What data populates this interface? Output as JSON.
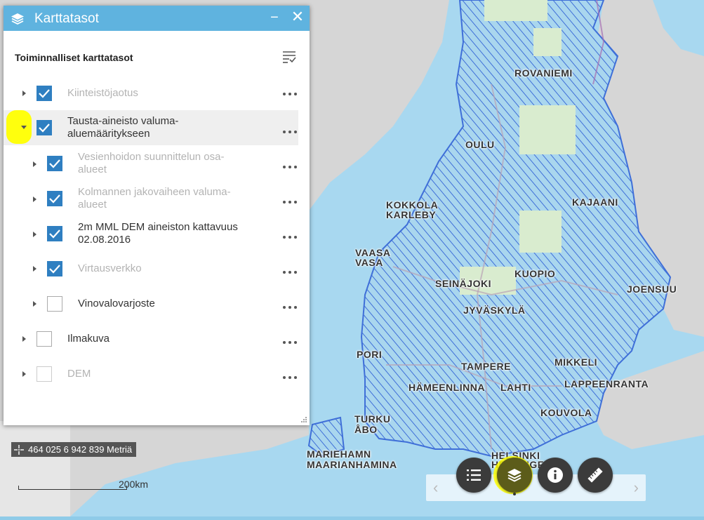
{
  "panel": {
    "title": "Karttatasot",
    "minimize_label": "−",
    "close_label": "✕",
    "section_title": "Toiminnalliset karttatasot",
    "layers": [
      {
        "label": "Kiinteistöjaotus",
        "checked": true,
        "expanded": false,
        "dim": true
      },
      {
        "label": "Tausta-aineisto valuma-aluemääritykseen",
        "checked": true,
        "expanded": true,
        "dim": false,
        "selected": true
      },
      {
        "label": "Vesienhoidon suunnittelun osa-alueet",
        "checked": true,
        "expanded": false,
        "dim": true,
        "child": true
      },
      {
        "label": "Kolmannen jakovaiheen valuma-alueet",
        "checked": true,
        "expanded": false,
        "dim": true,
        "child": true
      },
      {
        "label": "2m MML DEM aineiston kattavuus 02.08.2016",
        "checked": true,
        "expanded": false,
        "dim": false,
        "child": true
      },
      {
        "label": "Virtausverkko",
        "checked": true,
        "expanded": false,
        "dim": true,
        "child": true
      },
      {
        "label": "Vinovalovarjoste",
        "checked": false,
        "expanded": false,
        "dim": false,
        "child": true
      },
      {
        "label": "Ilmakuva",
        "checked": false,
        "expanded": false,
        "dim": false
      },
      {
        "label": "DEM",
        "checked": false,
        "expanded": false,
        "dim": true
      }
    ],
    "layer_lines": [
      [
        "Kiinteistöjaotus"
      ],
      [
        "Tausta-aineisto valuma-",
        "aluemääritykseen"
      ],
      [
        "Vesienhoidon suunnittelun osa-",
        "alueet"
      ],
      [
        "Kolmannen jakovaiheen valuma-",
        "alueet"
      ],
      [
        "2m MML DEM aineiston kattavuus",
        "02.08.2016"
      ],
      [
        "Virtausverkko"
      ],
      [
        "Vinovalovarjoste"
      ],
      [
        "Ilmakuva"
      ],
      [
        "DEM"
      ]
    ]
  },
  "coordinates": {
    "text": "464 025 6 942 839 Metriä"
  },
  "scale": {
    "label": "200km"
  },
  "map_labels": [
    "ROVANIEMI",
    "OULU",
    "KOKKOLA",
    "KARLEBY",
    "KAJAANI",
    "VAASA",
    "VASA",
    "KUOPIO",
    "SEINÄJOKI",
    "JOENSUU",
    "JYVÄSKYLÄ",
    "PORI",
    "TAMPERE",
    "MIKKELI",
    "HÄMEENLINNA",
    "LAHTI",
    "LAPPEENRANTA",
    "KOUVOLA",
    "TURKU",
    "ÅBO",
    "MARIEHAMN",
    "MAARIANHAMINA",
    "HELSINKI",
    "HELSINGFORS"
  ],
  "toolbar": {
    "buttons": [
      "layer-list",
      "layers",
      "info",
      "measure"
    ],
    "active": "layers",
    "prev_label": "‹",
    "next_label": "›"
  },
  "colors": {
    "header": "#5fb3df",
    "checkbox": "#2f7fc1",
    "sea": "#8fcbe8",
    "land": "#d9d9d9",
    "hatch": "#3f6fd8",
    "highlight": "#ffff00"
  }
}
